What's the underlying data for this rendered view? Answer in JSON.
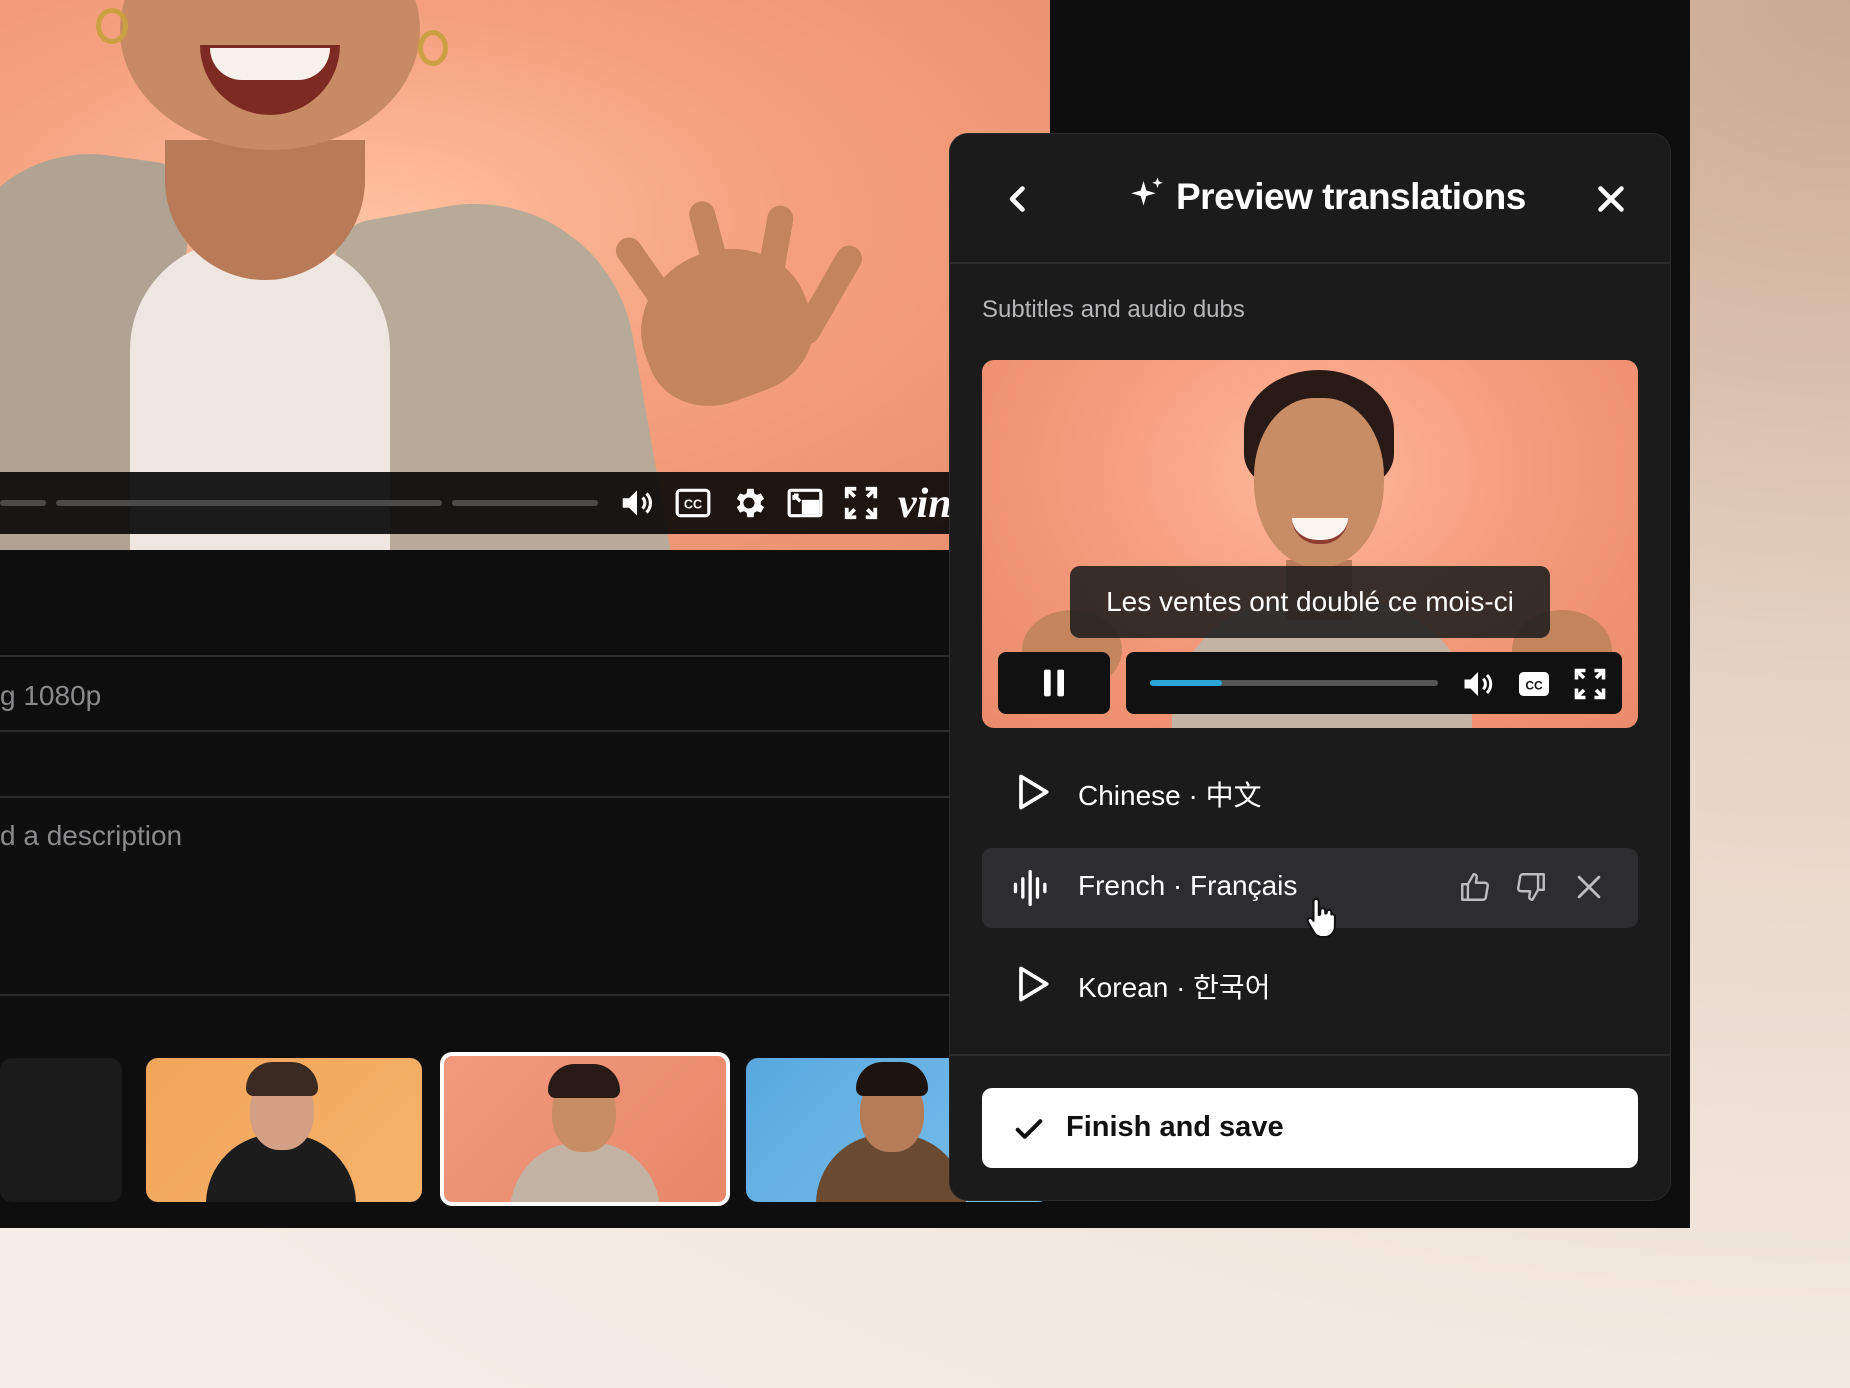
{
  "main_player": {
    "brand": "vin",
    "icons": [
      "volume-icon",
      "cc-icon",
      "settings-icon",
      "pip-icon",
      "fullscreen-icon"
    ]
  },
  "details": {
    "quality_text": "g 1080p",
    "description_placeholder": "d a description"
  },
  "panel": {
    "title": "Preview translations",
    "section_label": "Subtitles and audio dubs",
    "preview": {
      "caption": "Les ventes ont doublé ce mois-ci",
      "progress": 0.25
    },
    "languages": [
      {
        "label": "Chinese · 中文",
        "icon": "play-icon",
        "active": false
      },
      {
        "label": "French · Français",
        "icon": "audio-wave-icon",
        "active": true
      },
      {
        "label": "Korean · 한국어",
        "icon": "play-icon",
        "active": false
      }
    ],
    "finish_label": "Finish and save"
  },
  "colors": {
    "accent": "#29a6d6",
    "panel_bg": "#1b1b1c",
    "app_bg": "#0e0e0f"
  }
}
